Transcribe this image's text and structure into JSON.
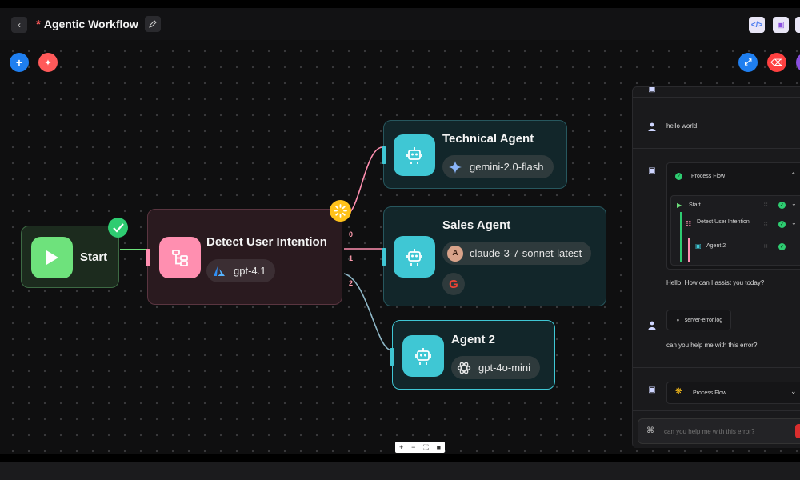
{
  "header": {
    "unsaved_marker": "*",
    "title": "Agentic Workflow"
  },
  "nodes": {
    "start": {
      "label": "Start"
    },
    "detect": {
      "title": "Detect User Intention",
      "model": "gpt-4.1"
    },
    "technical": {
      "title": "Technical Agent",
      "model": "gemini-2.0-flash"
    },
    "sales": {
      "title": "Sales Agent",
      "model": "claude-3-7-sonnet-latest"
    },
    "agent2": {
      "title": "Agent 2",
      "model": "gpt-4o-mini"
    }
  },
  "edges": {
    "labels": [
      "0",
      "1",
      "2"
    ]
  },
  "chat": {
    "msg1": "hello world!",
    "process_flow_label": "Process Flow",
    "flow_steps": [
      "Start",
      "Detect User Intention",
      "Agent 2"
    ],
    "assistant_reply": "Hello! How can I assist you today?",
    "attachment": "server-error.log",
    "msg2": "can you help me with this error?",
    "process_flow_label_2": "Process Flow",
    "input_placeholder": "can you help me with this error?"
  },
  "colors": {
    "accent_teal": "#3fc7d4",
    "start_green": "#6ee27c",
    "detect_pink": "#ff8fb0",
    "success": "#2ecc71"
  }
}
